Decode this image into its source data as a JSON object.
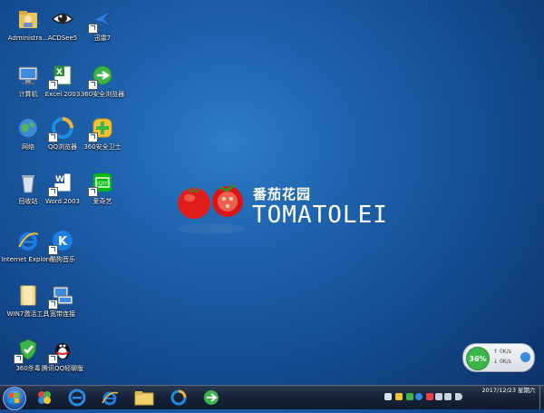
{
  "desktop_icons": [
    {
      "label": "Administra..."
    },
    {
      "label": "ACDSee5"
    },
    {
      "label": "迅雷7"
    },
    {
      "label": "计算机"
    },
    {
      "label": "Excel 2003"
    },
    {
      "label": "360安全浏览器"
    },
    {
      "label": "网络"
    },
    {
      "label": "QQ浏览器"
    },
    {
      "label": "360安全卫士"
    },
    {
      "label": "回收站"
    },
    {
      "label": "Word 2003"
    },
    {
      "label": "爱奇艺"
    },
    {
      "label": "Internet Explorer"
    },
    {
      "label": "酷狗音乐"
    },
    {
      "label": "WIN7激活工具"
    },
    {
      "label": "宽带连接"
    },
    {
      "label": "360杀毒"
    },
    {
      "label": "腾讯QQ轻聊版"
    }
  ],
  "brand": {
    "chinese": "番茄花园",
    "english": "TOMATOLEI"
  },
  "network_widget": {
    "percent": "36%",
    "upload": "0K/s",
    "download": "0K/s"
  },
  "clock": {
    "time": "",
    "date": "2017/12/23 星期六"
  },
  "colors": {
    "desktop": "#1e63ad",
    "taskbar": "#16233a",
    "accent": "#3bb54a"
  }
}
